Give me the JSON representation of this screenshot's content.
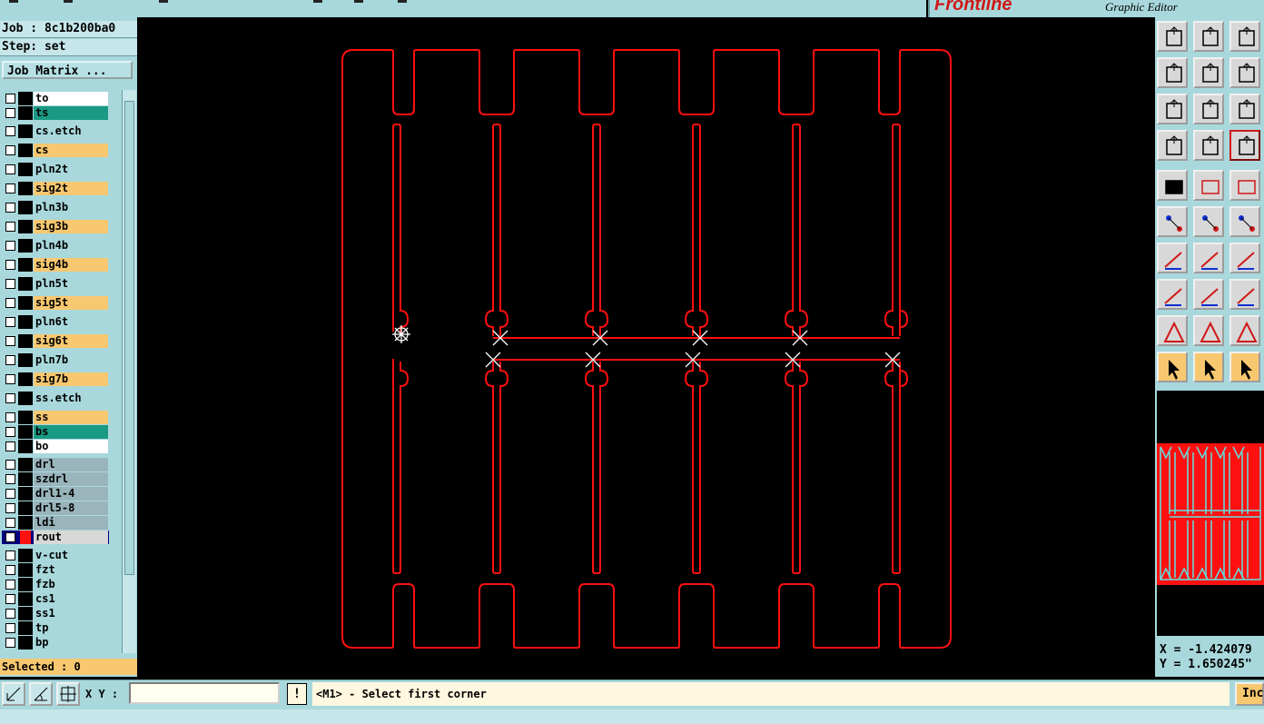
{
  "app": {
    "brand": "Frontline",
    "subtitle": "Graphic Editor"
  },
  "job": {
    "job_line": "Job : 8c1b200ba0",
    "step_line": "Step: set",
    "matrix_button": "Job Matrix ..."
  },
  "layers": [
    {
      "name": "to",
      "color": "#ffffff"
    },
    {
      "name": "ts",
      "color": "#1a9a84"
    },
    {
      "name": "cs.etch",
      "color": "#a8d8dc"
    },
    {
      "name": "cs",
      "color": "#f8c870"
    },
    {
      "name": "pln2t",
      "color": "#a8d8dc"
    },
    {
      "name": "sig2t",
      "color": "#f8c870"
    },
    {
      "name": "pln3b",
      "color": "#a8d8dc"
    },
    {
      "name": "sig3b",
      "color": "#f8c870"
    },
    {
      "name": "pln4b",
      "color": "#a8d8dc"
    },
    {
      "name": "sig4b",
      "color": "#f8c870"
    },
    {
      "name": "pln5t",
      "color": "#a8d8dc"
    },
    {
      "name": "sig5t",
      "color": "#f8c870"
    },
    {
      "name": "pln6t",
      "color": "#a8d8dc"
    },
    {
      "name": "sig6t",
      "color": "#f8c870"
    },
    {
      "name": "pln7b",
      "color": "#a8d8dc"
    },
    {
      "name": "sig7b",
      "color": "#f8c870"
    },
    {
      "name": "ss.etch",
      "color": "#a8d8dc"
    },
    {
      "name": "ss",
      "color": "#f8c870"
    },
    {
      "name": "bs",
      "color": "#1a9a84"
    },
    {
      "name": "bo",
      "color": "#ffffff"
    },
    {
      "name": "drl",
      "color": "#9ab4bc"
    },
    {
      "name": "szdrl",
      "color": "#9ab4bc"
    },
    {
      "name": "drl1-4",
      "color": "#9ab4bc"
    },
    {
      "name": "drl5-8",
      "color": "#9ab4bc"
    },
    {
      "name": "ldi",
      "color": "#9ab4bc"
    },
    {
      "name": "rout",
      "color": "#d8d8d8",
      "active": true
    },
    {
      "name": "v-cut",
      "color": "#a8d8dc"
    },
    {
      "name": "fzt",
      "color": "#a8d8dc"
    },
    {
      "name": "fzb",
      "color": "#a8d8dc"
    },
    {
      "name": "cs1",
      "color": "#a8d8dc"
    },
    {
      "name": "ss1",
      "color": "#a8d8dc"
    },
    {
      "name": "tp",
      "color": "#a8d8dc"
    },
    {
      "name": "bp",
      "color": "#a8d8dc"
    }
  ],
  "selected_text": "Selected : 0",
  "coords": {
    "x": "X = -1.424079",
    "y": "Y = 1.650245\""
  },
  "bottom": {
    "xy_label": "X Y :",
    "xy_value": "",
    "excl": "!",
    "status": "<M1> - Select first corner",
    "inc_label": "Inc"
  },
  "colors": {
    "outline": "#ff1010",
    "panel": "#a8d8dc",
    "highlight": "#f8c870"
  },
  "icons": {
    "toolbar_groups": [
      "view-tools",
      "snap-tools",
      "drawing-tools",
      "selection-tools"
    ]
  }
}
